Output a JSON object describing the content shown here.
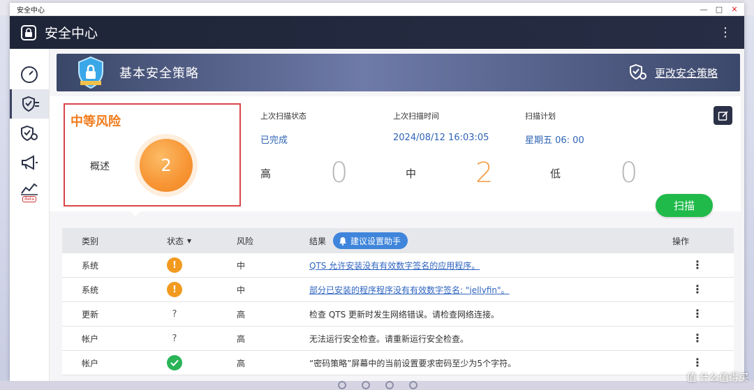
{
  "window": {
    "title": "安全中心"
  },
  "app": {
    "title": "安全中心"
  },
  "banner": {
    "title": "基本安全策略",
    "change_policy": "更改安全策略"
  },
  "summary": {
    "risk_level": "中等风险",
    "overview_label": "概述",
    "overview_count": "2",
    "last_scan_status_label": "上次扫描状态",
    "last_scan_status": "已完成",
    "last_scan_time_label": "上次扫描时间",
    "last_scan_time": "2024/08/12 16:03:05",
    "schedule_label": "扫描计划",
    "schedule": "星期五 06: 00",
    "counts": [
      {
        "label": "高",
        "value": "0",
        "color": "#b8b8b8"
      },
      {
        "label": "中",
        "value": "2",
        "color": "#f5a14c"
      },
      {
        "label": "低",
        "value": "0",
        "color": "#b8b8b8"
      }
    ],
    "scan_button": "扫描"
  },
  "table": {
    "headers": {
      "category": "类别",
      "status": "状态",
      "risk": "风险",
      "result": "结果",
      "advisor": "建议设置助手",
      "action": "操作"
    },
    "rows": [
      {
        "category": "系统",
        "status": "warning",
        "risk": "中",
        "result": "QTS 允许安装没有有效数字签名的应用程序。",
        "link": true
      },
      {
        "category": "系统",
        "status": "warning",
        "risk": "中",
        "result": "部分已安装的程序程序没有有效数字签名: \"jellyfin\"。",
        "link": true
      },
      {
        "category": "更新",
        "status": "unknown",
        "risk": "高",
        "result": "检查 QTS 更新时发生网络错误。请检查网络连接。",
        "link": false
      },
      {
        "category": "帐户",
        "status": "unknown",
        "risk": "高",
        "result": "无法运行安全检查。请重新运行安全检查。",
        "link": false
      },
      {
        "category": "帐户",
        "status": "ok",
        "risk": "高",
        "result": "“密码策略”屏幕中的当前设置要求密码至少为5个字符。",
        "link": false
      }
    ]
  },
  "sidebar": {
    "items": [
      {
        "name": "dashboard",
        "icon": "speedometer-icon"
      },
      {
        "name": "security-policy",
        "icon": "shield-list-icon"
      },
      {
        "name": "security-settings",
        "icon": "shield-gear-icon"
      },
      {
        "name": "announcements",
        "icon": "megaphone-icon"
      },
      {
        "name": "statistics",
        "icon": "chart-icon",
        "badge": "Beta"
      }
    ]
  },
  "watermark": "值 什么值得买",
  "colors": {
    "accent_green": "#1fba4a",
    "risk_orange": "#f07b1a",
    "link_blue": "#2f64c0",
    "header_dark": "#1f2538"
  }
}
